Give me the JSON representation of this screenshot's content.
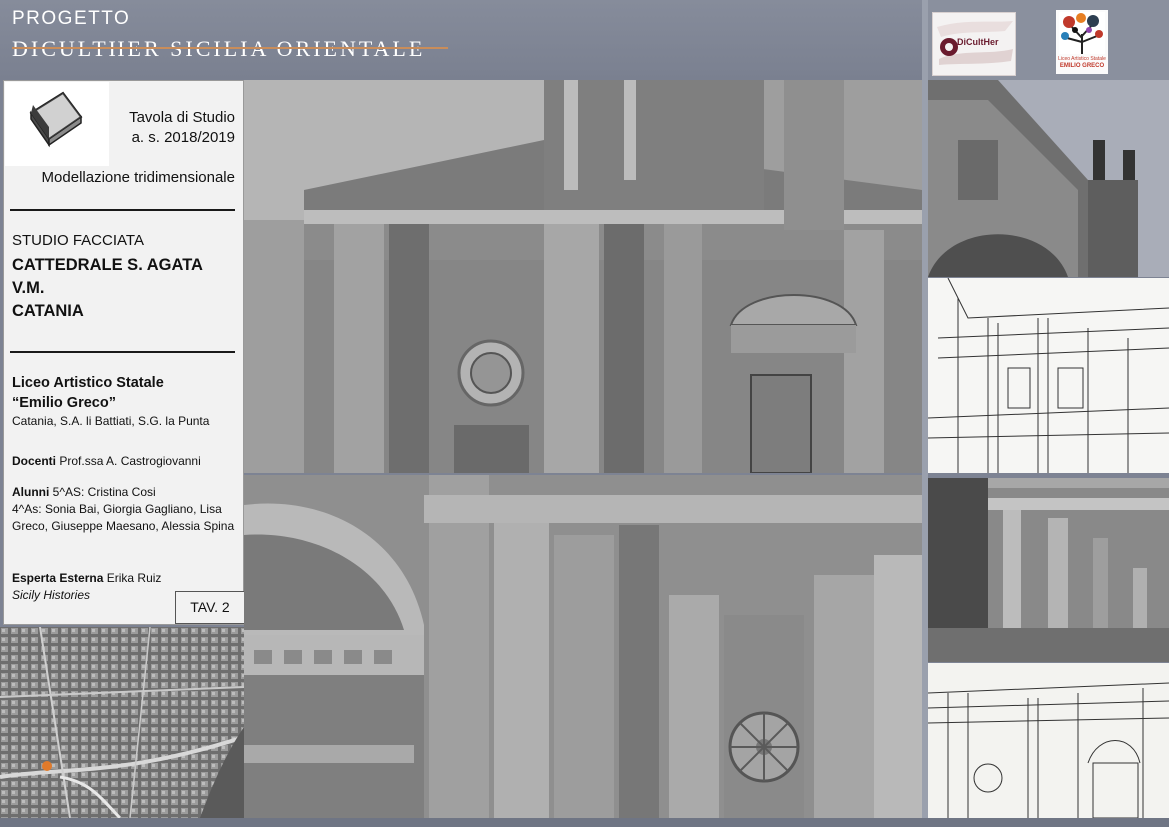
{
  "header": {
    "project_label": "PROGETTO",
    "project_title": "DICULTHER SICILIA ORIENTALE"
  },
  "logos": {
    "dicult_text": "DiCultHer",
    "liceo_line1": "Liceo Artistico Statale",
    "liceo_line2": "EMILIO GRECO"
  },
  "panel": {
    "tavola_line1": "Tavola di Studio",
    "tavola_line2": "a. s. 2018/2019",
    "modellazione": "Modellazione tridimensionale",
    "studio": "STUDIO FACCIATA",
    "subject_line1": "CATTEDRALE S. AGATA",
    "subject_line2": "V.M.",
    "subject_line3": "CATANIA",
    "school_line1": "Liceo Artistico Statale",
    "school_line2": "“Emilio Greco”",
    "school_location": "Catania, S.A. li Battiati, S.G. la Punta",
    "docenti_label": "Docenti",
    "docenti_value": "Prof.ssa A. Castrogiovanni",
    "alunni_label": "Alunni",
    "alunni_value": "5^AS: Cristina Cosi",
    "alunni_more": "4^As: Sonia Bai, Giorgia Gagliano, Lisa Greco, Giuseppe Maesano, Alessia Spina",
    "esperta_label": "Esperta Esterna",
    "esperta_value": "Erika Ruiz",
    "esperta_org": "Sicily Histories",
    "tav": "TAV. 2"
  },
  "icons": {
    "cube": "cube-icon",
    "map_marker": "map-marker-icon"
  },
  "colors": {
    "background": "#7d8393",
    "title_strike": "#c98d5a",
    "map_marker": "#e07a2a",
    "dicult_brand": "#6a1b2e",
    "liceo_brand": "#c0392b"
  }
}
